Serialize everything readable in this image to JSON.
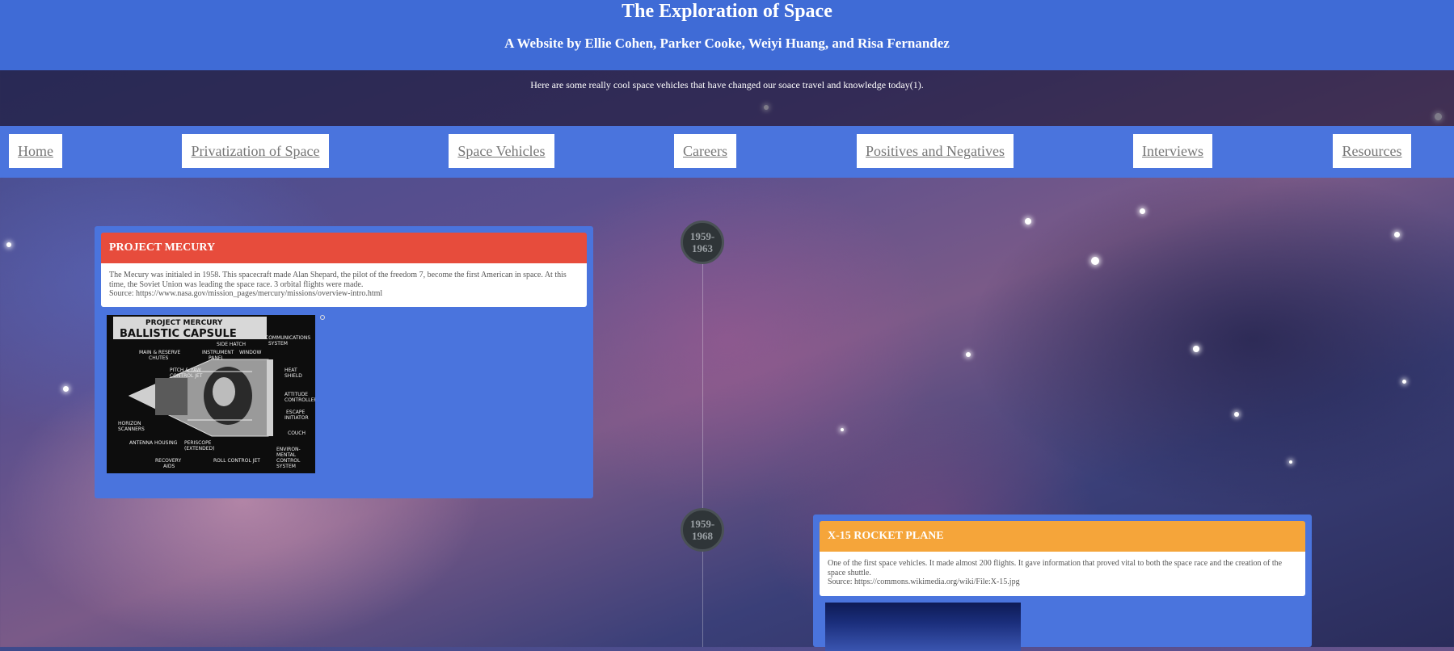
{
  "header": {
    "title": "The Exploration of Space",
    "subtitle": "A Website by Ellie Cohen, Parker Cooke, Weiyi Huang, and Risa Fernandez"
  },
  "intro": {
    "text": "Here are some really cool space vehicles that have changed our soace travel and knowledge today(1)."
  },
  "nav": {
    "items": [
      {
        "label": "Home"
      },
      {
        "label": "Privatization of Space"
      },
      {
        "label": "Space Vehicles"
      },
      {
        "label": "Careers"
      },
      {
        "label": "Positives and Negatives"
      },
      {
        "label": "Interviews"
      },
      {
        "label": "Resources"
      }
    ]
  },
  "timeline": {
    "entries": [
      {
        "date_start": "1959-",
        "date_end": "1963",
        "title": "PROJECT MECURY",
        "accent_color": "#e74c3c",
        "description": "The Mecury was initialed in 1958. This spacecraft made Alan Shepard, the pilot of the freedom 7, become the first American in space. At this time, the Soviet Union was leading the space race. 3 orbital flights were made.",
        "source": "Source: https://www.nasa.gov/mission_pages/mercury/missions/overview-intro.html",
        "image": {
          "header_line1": "PROJECT MERCURY",
          "header_line2": "BALLISTIC CAPSULE",
          "labels": [
            "COMMUNICATIONS SYSTEM",
            "SIDE HATCH",
            "MAIN & RESERVE CHUTES",
            "INSTRUMENT PANEL",
            "WINDOW",
            "PITCH & YAW CONTROL JET",
            "HEAT SHIELD",
            "ATTITUDE CONTROLLER",
            "ESCAPE INITIATOR",
            "HORIZON SCANNERS",
            "COUCH",
            "PERISCOPE (EXTENDED)",
            "ANTENNA HOUSING",
            "ENVIRON-MENTAL CONTROL SYSTEM",
            "RECOVERY AIDS",
            "ROLL CONTROL JET"
          ]
        }
      },
      {
        "date_start": "1959-",
        "date_end": "1968",
        "title": "X-15 ROCKET PLANE",
        "accent_color": "#f5a53a",
        "description": "One of the first space vehicles. It made almost 200 flights. It gave information that proved vital to both the space race and the creation of the space shuttle.",
        "source": "Source: https://commons.wikimedia.org/wiki/File:X-15.jpg"
      }
    ]
  },
  "colors": {
    "header_bg": "#3f6bd6",
    "nav_bg": "#4a74dd",
    "card_bg": "#4a74dd"
  }
}
